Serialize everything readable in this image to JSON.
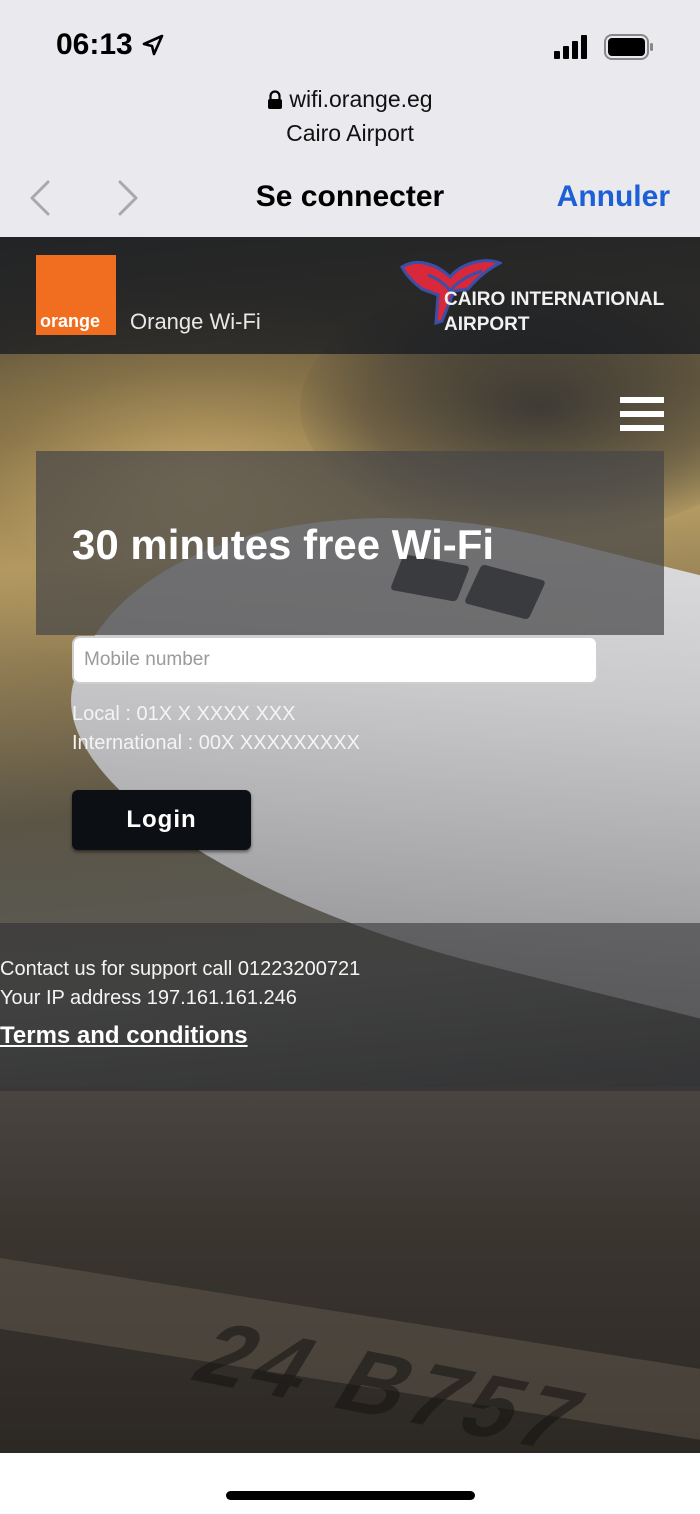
{
  "status_bar": {
    "time": "06:13",
    "icons": [
      "location-arrow-icon",
      "signal-icon",
      "battery-icon"
    ]
  },
  "captive_portal": {
    "url": "wifi.orange.eg",
    "subtitle": "Cairo Airport",
    "title": "Se connecter",
    "cancel_label": "Annuler",
    "icons": [
      "lock-icon",
      "chevron-left-icon",
      "chevron-right-icon"
    ]
  },
  "header": {
    "orange_logo_text": "orange",
    "brand_name": "Orange Wi-Fi",
    "airport_line1": "CAIRO INTERNATIONAL",
    "airport_line2": "AIRPORT",
    "brand_color": "#f16e21"
  },
  "hero": {
    "title": "30 minutes free Wi-Fi"
  },
  "login_form": {
    "mobile_placeholder": "Mobile number",
    "mobile_value": "",
    "hint_local": "Local : 01X X XXXX XXX",
    "hint_international": "International : 00X XXXXXXXXX",
    "login_label": "Login"
  },
  "footer": {
    "support": "Contact us for support call 01223200721",
    "ip": "Your IP address 197.161.161.246",
    "terms": "Terms and conditions"
  },
  "runway_marking": "24 B757"
}
